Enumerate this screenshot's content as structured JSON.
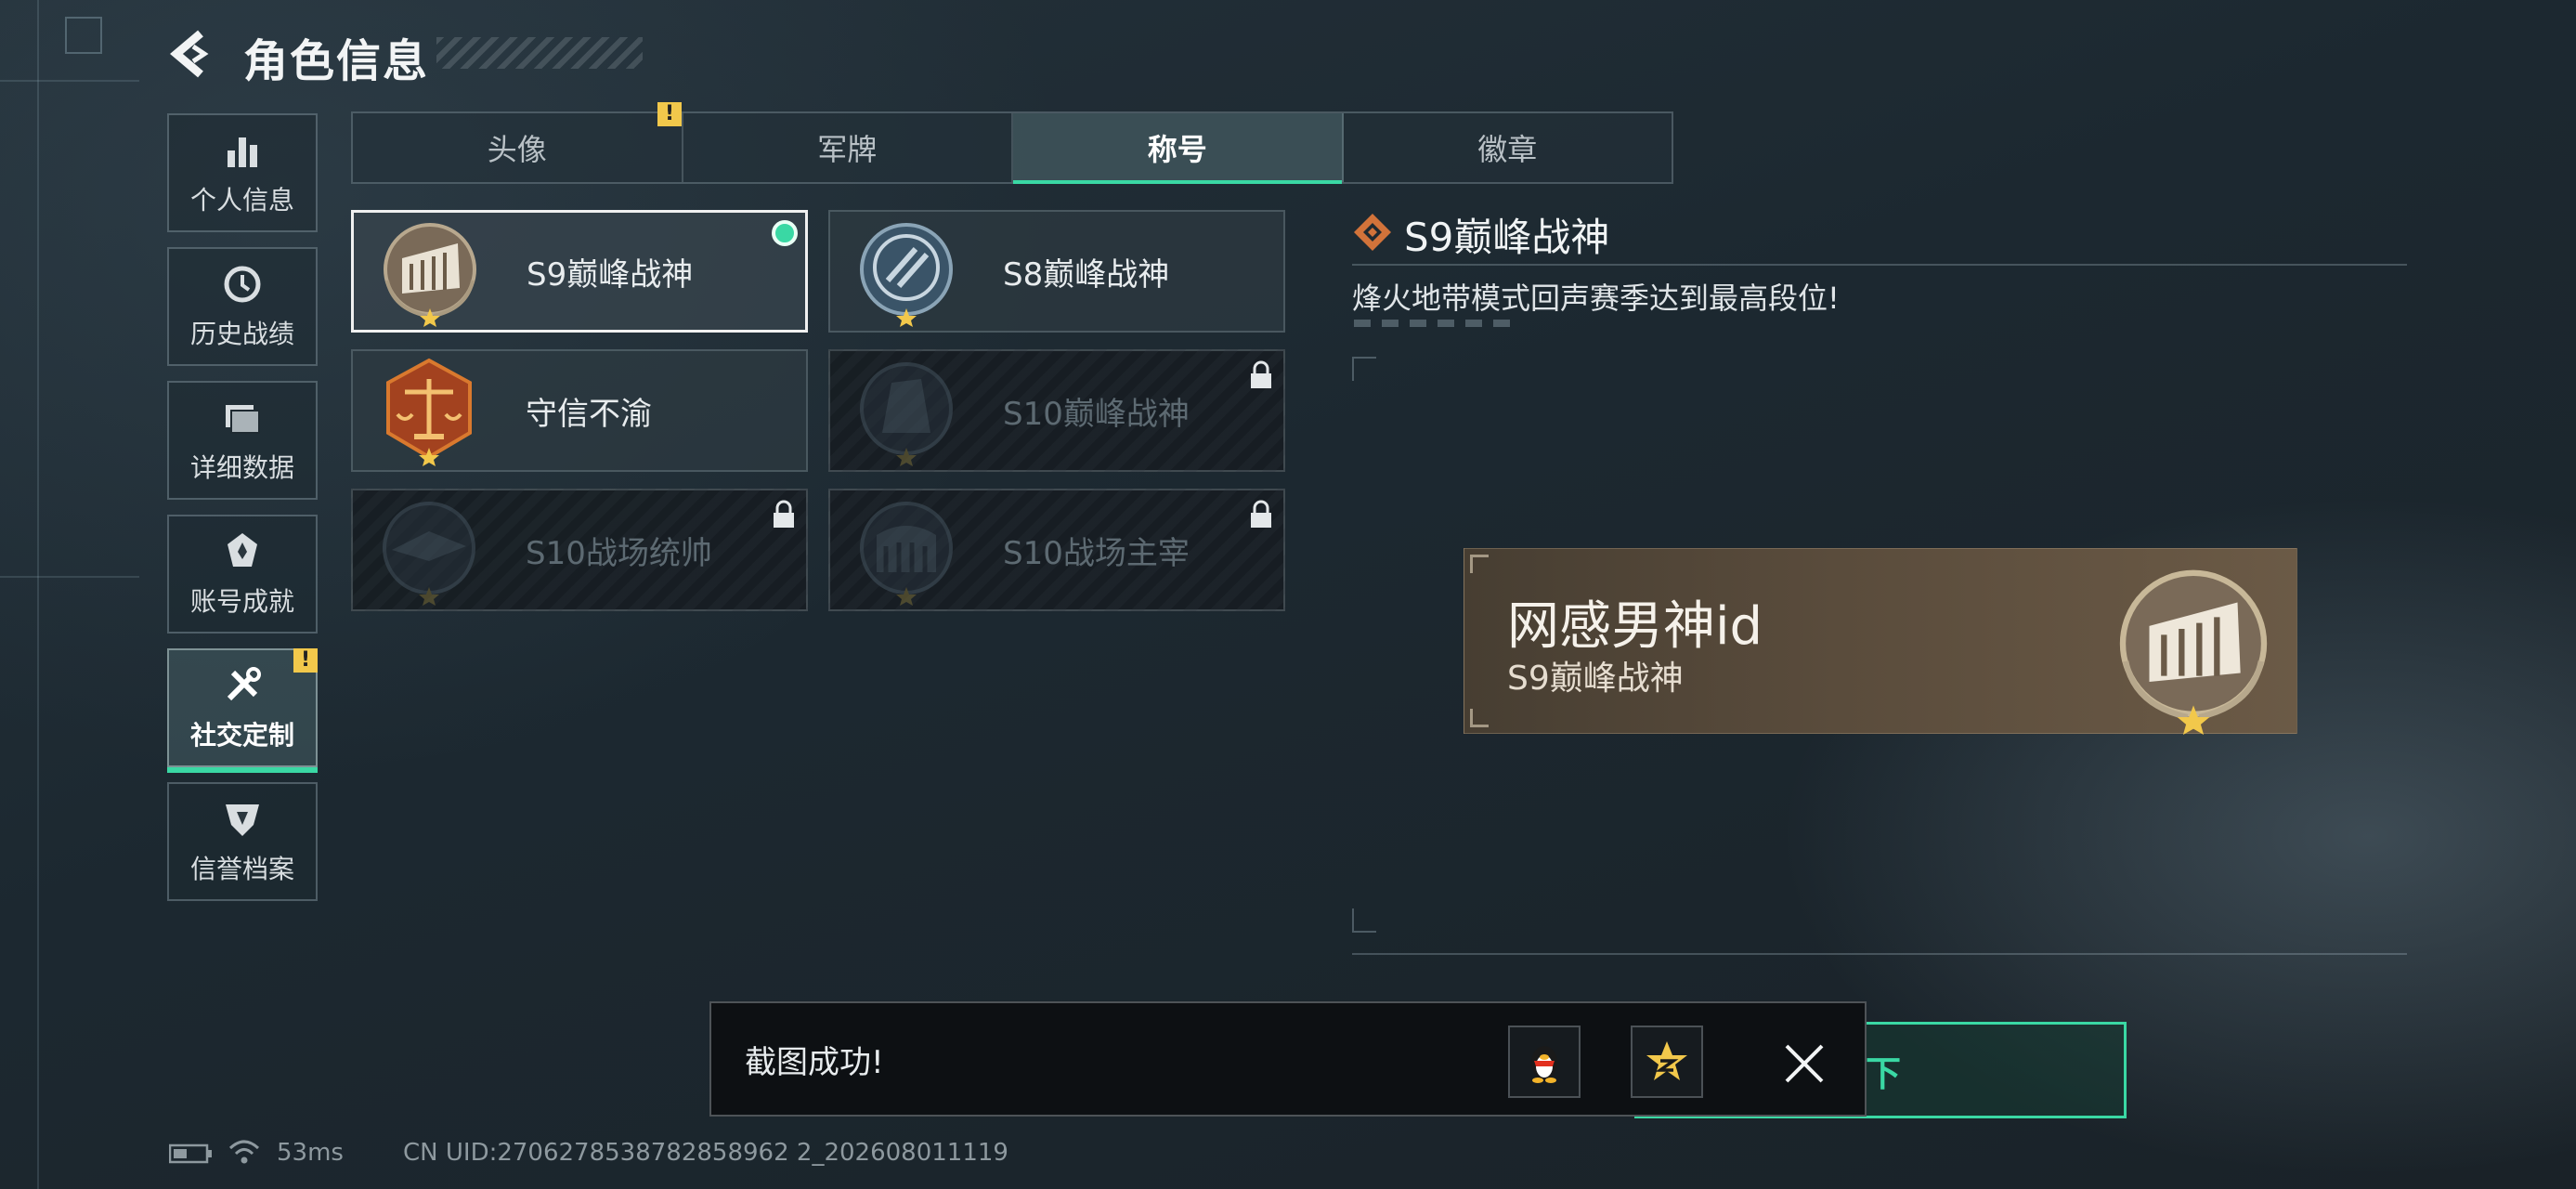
{
  "header": {
    "title": "角色信息",
    "back_icon": "back-arrow-icon"
  },
  "sidebar": {
    "items": [
      {
        "label": "个人信息",
        "icon": "bar-chart-icon",
        "active": false
      },
      {
        "label": "历史战绩",
        "icon": "history-clock-icon",
        "active": false
      },
      {
        "label": "详细数据",
        "icon": "folder-icon",
        "active": false
      },
      {
        "label": "账号成就",
        "icon": "achievement-icon",
        "active": false
      },
      {
        "label": "社交定制",
        "icon": "tools-icon",
        "active": true,
        "alert": "!"
      },
      {
        "label": "信誉档案",
        "icon": "credit-shield-icon",
        "active": false
      }
    ]
  },
  "tabs": [
    {
      "label": "头像",
      "alert": "!"
    },
    {
      "label": "军牌"
    },
    {
      "label": "称号",
      "active": true
    },
    {
      "label": "徽章"
    }
  ],
  "titles": [
    {
      "name": "S9巅峰战神",
      "selected": true,
      "equipped": true,
      "locked": false
    },
    {
      "name": "S8巅峰战神",
      "locked": false
    },
    {
      "name": "守信不渝",
      "locked": false
    },
    {
      "name": "S10巅峰战神",
      "locked": true
    },
    {
      "name": "S10战场统帅",
      "locked": true
    },
    {
      "name": "S10战场主宰",
      "locked": true
    }
  ],
  "detail": {
    "title": "S9巅峰战神",
    "description": "烽火地带模式回声赛季达到最高段位!"
  },
  "preview": {
    "player_name": "网感男神id",
    "title": "S9巅峰战神"
  },
  "unequip_button": {
    "label": "卸下"
  },
  "toast": {
    "message": "截图成功!",
    "share_qq_icon": "qq-penguin-icon",
    "share_qzone_icon": "qzone-star-icon",
    "close_icon": "close-icon"
  },
  "status_bar": {
    "ping": "53ms",
    "uid": "CN UID:2706278538782858962 2_202608011119"
  },
  "colors": {
    "accent": "#3ad8a4",
    "alert": "#f2c84b",
    "preview_bg": "#5a4c3c"
  }
}
